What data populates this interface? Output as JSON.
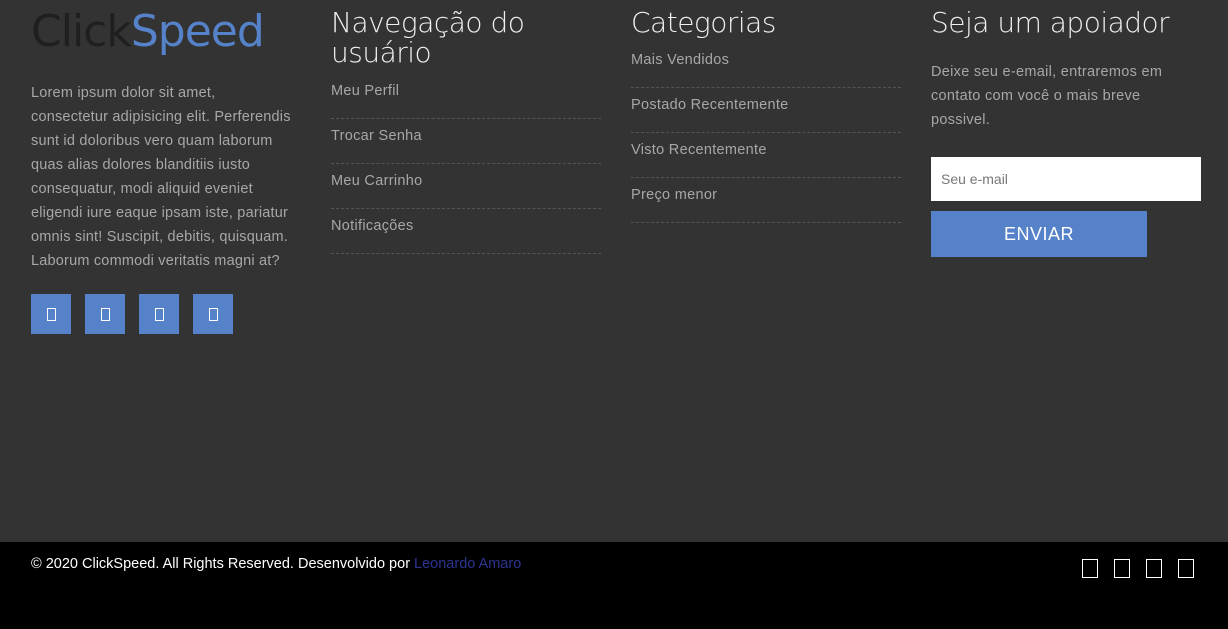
{
  "brand": {
    "logo_part1": "Click",
    "logo_part2": "Speed",
    "description": "Lorem ipsum dolor sit amet, consectetur adipisicing elit. Perferendis sunt id doloribus vero quam laborum quas alias dolores blanditiis iusto consequatur, modi aliquid eveniet eligendi iure eaque ipsam iste, pariatur omnis sint! Suscipit, debitis, quisquam. Laborum commodi veritatis magni at?",
    "social_icons": [
      "social-icon-1",
      "social-icon-2",
      "social-icon-3",
      "social-icon-4"
    ]
  },
  "user_nav": {
    "title": "Navegação do usuário",
    "items": [
      {
        "label": "Meu Perfil"
      },
      {
        "label": "Trocar Senha"
      },
      {
        "label": "Meu Carrinho"
      },
      {
        "label": "Notificações"
      }
    ]
  },
  "categories": {
    "title": "Categorias",
    "items": [
      {
        "label": "Mais Vendidos"
      },
      {
        "label": "Postado Recentemente"
      },
      {
        "label": "Visto Recentemente"
      },
      {
        "label": "Preço menor"
      }
    ]
  },
  "subscribe": {
    "title": "Seja um apoiador",
    "text": "Deixe seu e-email, entraremos em contato com você o mais breve possivel.",
    "email_placeholder": "Seu e-mail",
    "email_value": "",
    "submit_label": "ENVIAR"
  },
  "bottom": {
    "copyright": "© 2020 ClickSpeed. All Rights Reserved. Desenvolvido por ",
    "author_link": "Leonardo Amaro",
    "icons": [
      "social-icon-1",
      "social-icon-2",
      "social-icon-3",
      "social-icon-4"
    ]
  },
  "colors": {
    "accent": "#5582c9",
    "footer_bg": "#333333",
    "bottom_bar_bg": "#000000",
    "text_muted": "#a7a7a7",
    "link_dark": "#2c3590"
  }
}
